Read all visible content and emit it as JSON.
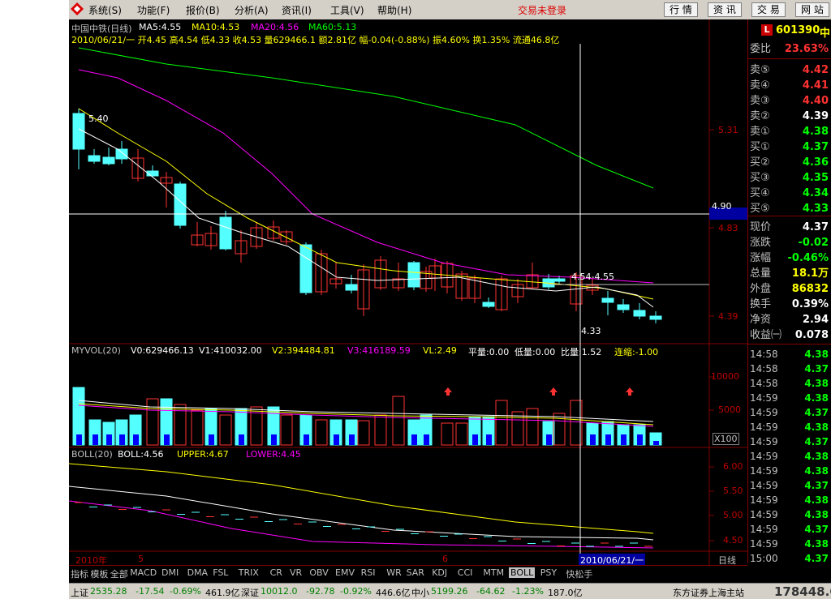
{
  "menubar": {
    "items": [
      "系统(S)",
      "功能(F)",
      "报价(B)",
      "分析(A)",
      "资讯(I)",
      "工具(V)",
      "帮助(H)"
    ],
    "login_status": "交易未登录",
    "buttons": [
      "行 情",
      "资 讯",
      "交 易",
      "网 站"
    ]
  },
  "kline": {
    "title": "中国中铁(日线)",
    "ma5": "MA5:4.55",
    "ma10": "MA10:4.53",
    "ma20": "MA20:4.56",
    "ma60": "MA60:5.13",
    "info": "2010/06/21/一 开4.45 高4.54 低4.33 收4.53 量629466.1 额2.81亿 幅-0.04(-0.88%) 振4.60% 换1.35% 流通46.8亿",
    "high_label": "5.40",
    "low_label": "4.33",
    "crosshair_label": "4.54-4.55",
    "cursor_price": "4.90"
  },
  "volume": {
    "title": "MYVOL(20)",
    "v0": "V0:629466.13",
    "v1": "V1:410032.00",
    "v2": "V2:394484.81",
    "v3": "V3:416189.59",
    "vl": "VL:2.49",
    "pl": "平量:0.00",
    "dl": "低量:0.00",
    "bl": "比量:1.52",
    "ls": "连缩:-1.00",
    "unit": "X100"
  },
  "boll": {
    "title": "BOLL(20)",
    "boll": "BOLL:4.56",
    "upper": "UPPER:4.67",
    "lower": "LOWER:4.45"
  },
  "bottom_tabs": [
    "指标",
    "模板",
    "全部",
    "MACD",
    "DMI",
    "DMA",
    "FSL",
    "TRIX",
    "CR",
    "VR",
    "OBV",
    "EMV",
    "RSI",
    "WR",
    "SAR",
    "KDJ",
    "CCI",
    "MTM",
    "BOLL",
    "PSY",
    "快松手"
  ],
  "date_axis": {
    "year": "2010年",
    "m5": "5",
    "m6": "6",
    "cursor_date": "2010/06/21/一",
    "period": "日线"
  },
  "quote": {
    "code": "601390",
    "name_short": "中",
    "weibi_label": "委比",
    "weibi_value": "23.63%",
    "sells": [
      {
        "label": "卖⑤",
        "price": "4.42"
      },
      {
        "label": "卖④",
        "price": "4.41"
      },
      {
        "label": "卖③",
        "price": "4.40"
      },
      {
        "label": "卖②",
        "price": "4.39"
      },
      {
        "label": "卖①",
        "price": "4.38"
      }
    ],
    "buys": [
      {
        "label": "买①",
        "price": "4.37"
      },
      {
        "label": "买②",
        "price": "4.36"
      },
      {
        "label": "买③",
        "price": "4.35"
      },
      {
        "label": "买④",
        "price": "4.34"
      },
      {
        "label": "买⑤",
        "price": "4.33"
      }
    ],
    "stats": [
      {
        "label": "现价",
        "value": "4.37"
      },
      {
        "label": "涨跌",
        "value": "-0.02"
      },
      {
        "label": "涨幅",
        "value": "-0.46%"
      },
      {
        "label": "总量",
        "value": "18.1万"
      },
      {
        "label": "外盘",
        "value": "86832"
      },
      {
        "label": "换手",
        "value": "0.39%"
      },
      {
        "label": "净资",
        "value": "2.94"
      },
      {
        "label": "收益㈠",
        "value": "0.078"
      }
    ],
    "ticks": [
      {
        "time": "14:58",
        "price": "4.38"
      },
      {
        "time": "14:58",
        "price": "4.37"
      },
      {
        "time": "14:58",
        "price": "4.38"
      },
      {
        "time": "14:59",
        "price": "4.38"
      },
      {
        "time": "14:59",
        "price": "4.37"
      },
      {
        "time": "14:59",
        "price": "4.38"
      },
      {
        "time": "14:59",
        "price": "4.37"
      },
      {
        "time": "14:59",
        "price": "4.38"
      },
      {
        "time": "14:59",
        "price": "4.38"
      },
      {
        "time": "14:59",
        "price": "4.37"
      },
      {
        "time": "14:59",
        "price": "4.38"
      },
      {
        "time": "14:59",
        "price": "4.38"
      },
      {
        "time": "14:59",
        "price": "4.37"
      },
      {
        "time": "14:59",
        "price": "4.38"
      },
      {
        "time": "15:00",
        "price": "4.37"
      }
    ]
  },
  "status": {
    "sh_label": "上证",
    "sh_value": "2535.28",
    "sh_change": "-17.54",
    "sh_pct": "-0.69%",
    "sh_amount": "461.9亿",
    "sz_label": "深证",
    "sz_value": "10012.0",
    "sz_change": "-92.78",
    "sz_pct": "-0.92%",
    "sz_amount": "446.6亿",
    "zx_label": "中小",
    "zx_value": "5199.26",
    "zx_change": "-64.62",
    "zx_pct": "-1.23%",
    "zx_amount": "187.0亿",
    "broker": "东方证券上海主站",
    "watermark": "178448.COM"
  },
  "colors": {
    "up": "#ff3232",
    "down": "#54ffff",
    "ma5": "#ffffff",
    "ma10": "#ffff00",
    "ma20": "#ff00ff",
    "ma60": "#00ff00"
  }
}
